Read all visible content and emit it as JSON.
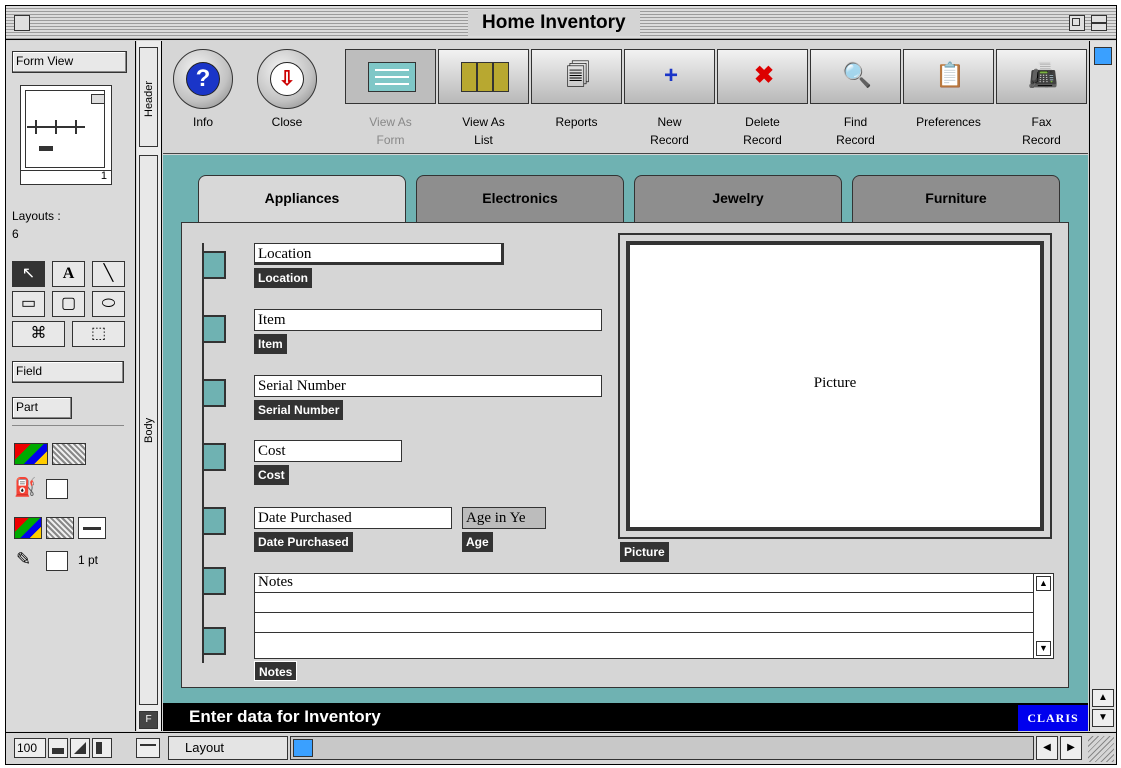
{
  "window": {
    "title": "Home Inventory"
  },
  "left_panel": {
    "view_mode": "Form View",
    "page_number": "1",
    "layouts_label": "Layouts :",
    "layouts_count": "6",
    "field_button": "Field",
    "part_button": "Part",
    "line_width": "1 pt"
  },
  "part_labels": {
    "header": "Header",
    "body": "Body",
    "footer": "F"
  },
  "toolbar": {
    "info": "Info",
    "close": "Close",
    "view_as_form": [
      "View As",
      "Form"
    ],
    "view_as_list": [
      "View As",
      "List"
    ],
    "reports": "Reports",
    "new_record": [
      "New",
      "Record"
    ],
    "delete_record": [
      "Delete",
      "Record"
    ],
    "find_record": [
      "Find",
      "Record"
    ],
    "preferences": "Preferences",
    "fax_record": [
      "Fax",
      "Record"
    ]
  },
  "tabs": [
    "Appliances",
    "Electronics",
    "Jewelry",
    "Furniture"
  ],
  "fields": {
    "location": {
      "value": "Location",
      "label": "Location"
    },
    "item": {
      "value": "Item",
      "label": "Item"
    },
    "serial": {
      "value": "Serial Number",
      "label": "Serial Number"
    },
    "cost": {
      "value": "Cost",
      "label": "Cost"
    },
    "date": {
      "value": "Date Purchased",
      "label": "Date Purchased"
    },
    "age": {
      "value": "Age in Ye",
      "label": "Age"
    },
    "picture": {
      "value": "Picture",
      "label": "Picture"
    },
    "notes": {
      "value": "Notes",
      "label": "Notes"
    }
  },
  "status": {
    "message": "Enter data for Inventory",
    "brand": "CLARIS"
  },
  "bottom_bar": {
    "zoom": "100",
    "mode": "Layout"
  },
  "colors": {
    "content_bg": "#6fb2b2",
    "status_bg": "#000000",
    "brand_bg": "#0000ee"
  }
}
